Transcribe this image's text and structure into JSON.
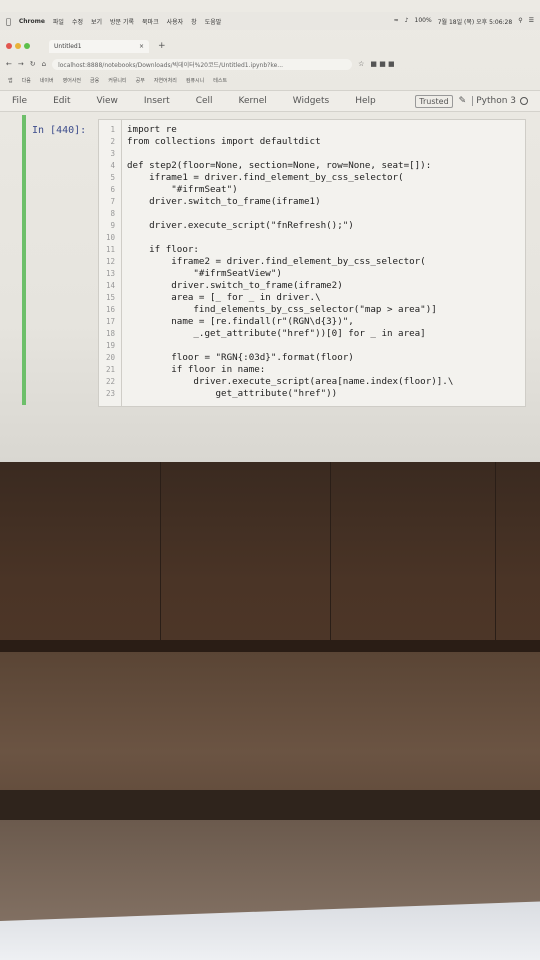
{
  "menubar": {
    "app": "Chrome",
    "items": [
      "파일",
      "수정",
      "보기",
      "방문 기록",
      "북마크",
      "사용자",
      "창",
      "도움말"
    ],
    "battery": "100%",
    "datetime": "7월 18일 (목) 오후 5:06:28"
  },
  "browser": {
    "tab_title": "Untitled1",
    "tab_close": "×",
    "new_tab": "+",
    "url": "localhost:8888/notebooks/Downloads/빅데이터%20코드/Untitled1.ipynb?ke...",
    "bookmarks": [
      "앱",
      "다음",
      "네이버",
      "영어사전",
      "금융",
      "커뮤니티",
      "공부",
      "자연어처리",
      "컴퓨시니",
      "테스트"
    ]
  },
  "jupyter": {
    "menu": [
      "File",
      "Edit",
      "View",
      "Insert",
      "Cell",
      "Kernel",
      "Widgets",
      "Help"
    ],
    "trusted": "Trusted",
    "kernel": "Python 3"
  },
  "cell": {
    "prompt": "In [440]:",
    "lines": [
      {
        "n": "1",
        "code": "import re"
      },
      {
        "n": "2",
        "code": "from collections import defaultdict"
      },
      {
        "n": "3",
        "code": ""
      },
      {
        "n": "4",
        "code": "def step2(floor=None, section=None, row=None, seat=[]):"
      },
      {
        "n": "5",
        "code": "    iframe1 = driver.find_element_by_css_selector("
      },
      {
        "n": "6",
        "code": "        \"#ifrmSeat\")"
      },
      {
        "n": "7",
        "code": "    driver.switch_to_frame(iframe1)"
      },
      {
        "n": "8",
        "code": ""
      },
      {
        "n": "9",
        "code": "    driver.execute_script(\"fnRefresh();\")"
      },
      {
        "n": "10",
        "code": ""
      },
      {
        "n": "11",
        "code": "    if floor:"
      },
      {
        "n": "12",
        "code": "        iframe2 = driver.find_element_by_css_selector("
      },
      {
        "n": "13",
        "code": "            \"#ifrmSeatView\")"
      },
      {
        "n": "14",
        "code": "        driver.switch_to_frame(iframe2)"
      },
      {
        "n": "15",
        "code": "        area = [_ for _ in driver.\\"
      },
      {
        "n": "16",
        "code": "            find_elements_by_css_selector(\"map > area\")]"
      },
      {
        "n": "17",
        "code": "        name = [re.findall(r\"(RGN\\d{3})\","
      },
      {
        "n": "18",
        "code": "            _.get_attribute(\"href\"))[0] for _ in area]"
      },
      {
        "n": "19",
        "code": ""
      },
      {
        "n": "20",
        "code": "        floor = \"RGN{:03d}\".format(floor)"
      },
      {
        "n": "21",
        "code": "        if floor in name:"
      },
      {
        "n": "22",
        "code": "            driver.execute_script(area[name.index(floor)].\\"
      },
      {
        "n": "23",
        "code": "                get_attribute(\"href\"))"
      }
    ]
  }
}
